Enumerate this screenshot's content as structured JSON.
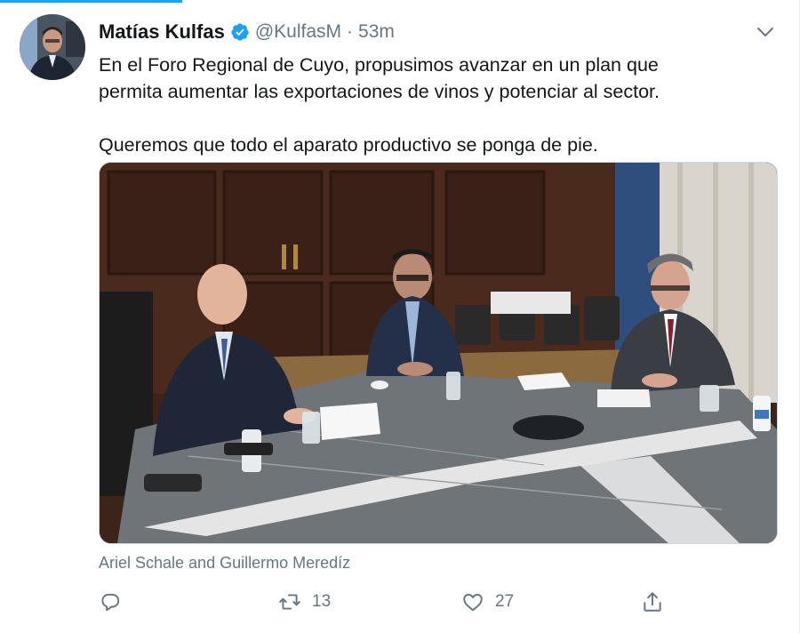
{
  "tweet": {
    "author_name": "Matías Kulfas",
    "handle": "@KulfasM",
    "separator": "·",
    "time": "53m",
    "text_lines": [
      "En el Foro Regional de Cuyo, propusimos avanzar en un plan que",
      "permita aumentar las exportaciones de vinos y potenciar al sector.",
      "Queremos que todo el aparato productivo se ponga de pie."
    ],
    "media_caption": "Ariel Schale and Guillermo Meredíz"
  },
  "actions": {
    "reply_count": "",
    "retweet_count": "13",
    "like_count": "27"
  },
  "colors": {
    "accent": "#1da1f2",
    "muted": "#657786",
    "text": "#14171a"
  },
  "icons": {
    "verified": "verified-badge-icon",
    "caret": "chevron-down-icon",
    "reply": "reply-icon",
    "retweet": "retweet-icon",
    "like": "heart-icon",
    "share": "share-icon"
  }
}
